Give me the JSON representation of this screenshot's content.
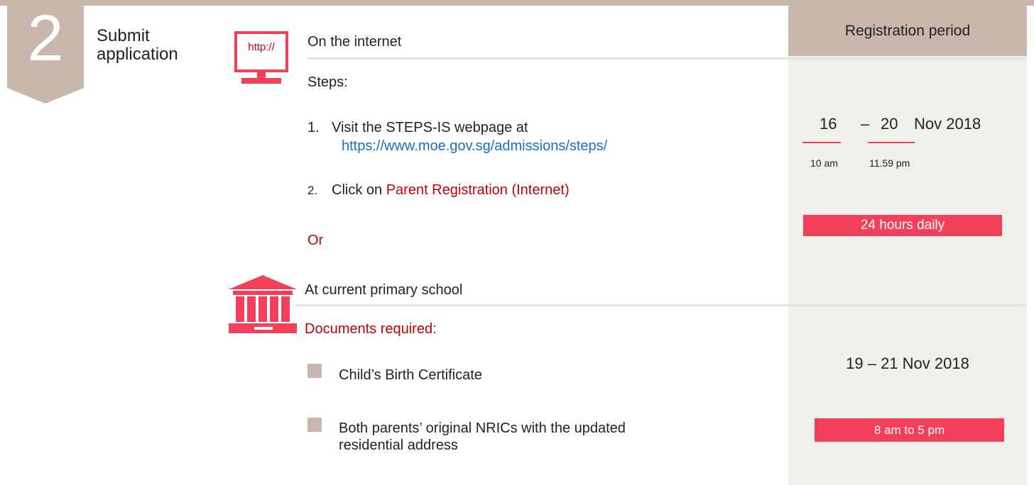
{
  "step": {
    "number": "2",
    "title_line1": "Submit",
    "title_line2": "application"
  },
  "internet": {
    "icon_text": "http://",
    "heading": "On the internet",
    "steps_label": "Steps:",
    "step1_num": "1.",
    "step1_text": "Visit the STEPS-IS webpage at",
    "step1_link": "https://www.moe.gov.sg/admissions/steps/",
    "step2_num": "2.",
    "step2_text": "Click on ",
    "step2_highlight": "Parent Registration (Internet)"
  },
  "or_text": "Or",
  "school": {
    "heading": "At current primary school",
    "docs_label": "Documents required:",
    "doc1": "Child’s Birth Certificate",
    "doc2_line1": "Both parents’ original NRICs with the updated",
    "doc2_line2": "residential address"
  },
  "registration": {
    "header": "Registration period",
    "internet_start_day": "16",
    "dash": "–",
    "internet_end_day": "20",
    "internet_month_year": "Nov 2018",
    "start_time": "10 am",
    "end_time": "11.59 pm",
    "internet_hours": "24 hours daily",
    "school_dates": "19 – 21 Nov 2018",
    "school_hours": "8 am to 5 pm"
  },
  "colors": {
    "accent": "#f2405a",
    "taupe": "#c9b7ac",
    "red_text": "#c0000c",
    "link": "#1a6fbf",
    "panel_bg": "#eff0ec"
  }
}
